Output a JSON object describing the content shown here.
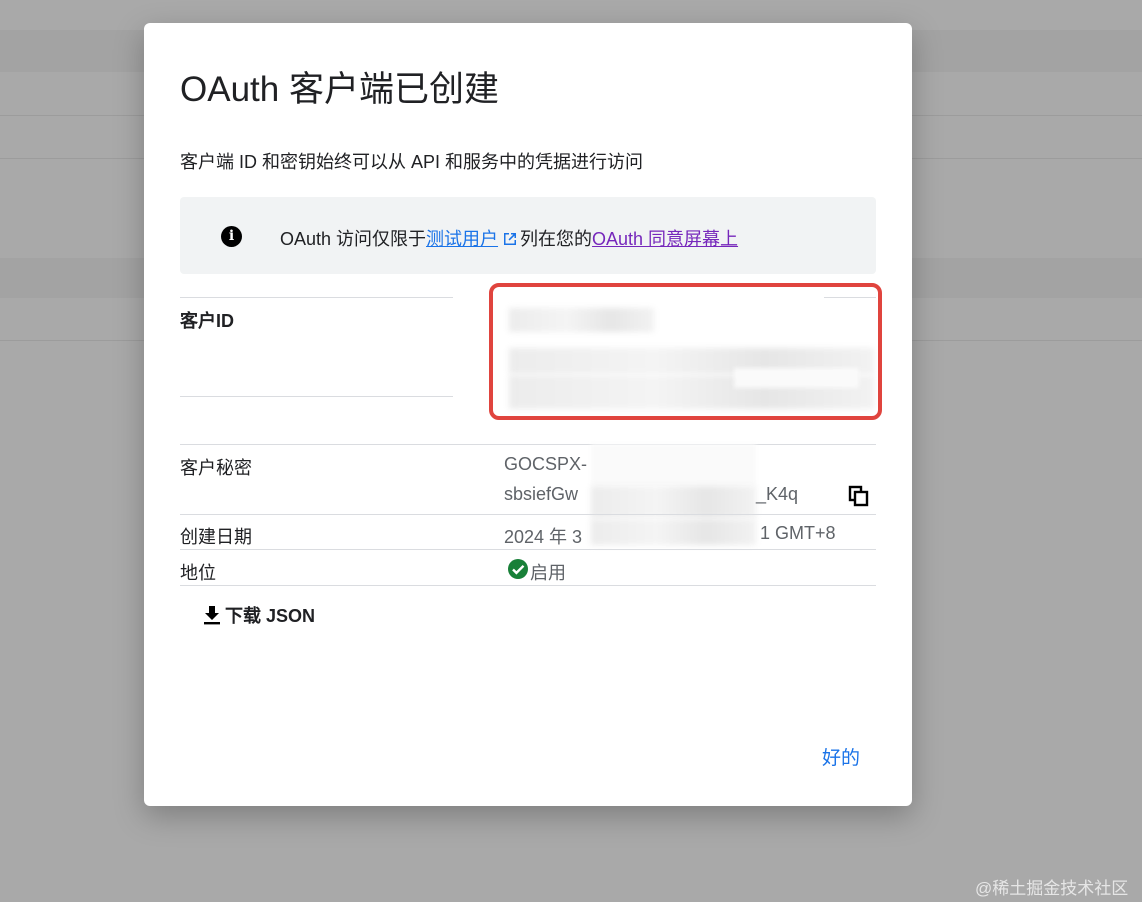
{
  "dialog": {
    "title": "OAuth 客户端已创建",
    "subtitle": "客户端 ID 和密钥始终可以从 API 和服务中的凭据进行访问",
    "info": {
      "prefix": "OAuth 访问仅限于",
      "link_test_users": "测试用户",
      "middle": "列在您的",
      "link_consent": "OAuth 同意屏幕上"
    },
    "client_id": {
      "label": "客户ID"
    },
    "client_secret": {
      "label": "客户秘密",
      "line1": "GOCSPX-",
      "line2_start": "sbsiefGw",
      "line2_end": "_K4q"
    },
    "created": {
      "label": "创建日期",
      "value_start": "2024 年 3",
      "value_end": "1 GMT+8"
    },
    "status": {
      "label": "地位",
      "value": "启用"
    },
    "download_label": "下载 JSON",
    "ok_label": "好的"
  },
  "watermark": "@稀土掘金技术社区",
  "colors": {
    "link": "#1a73e8",
    "link_visited": "#7627bb",
    "highlight_border": "#e0443e",
    "status_ok": "#188038"
  },
  "icons": [
    "info-icon",
    "external-link-icon",
    "copy-icon",
    "check-circle-icon",
    "download-icon"
  ]
}
